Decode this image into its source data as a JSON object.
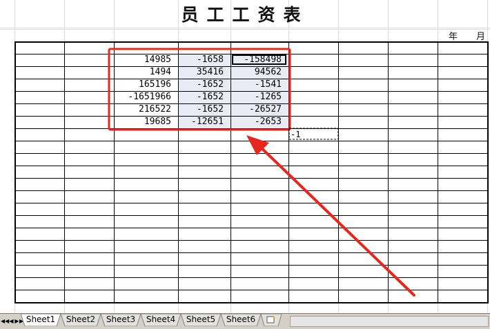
{
  "sheet": {
    "title": "员工工资表",
    "year_label": "年",
    "month_label": "月",
    "values": [
      [
        "14985",
        "-1658",
        "-158498"
      ],
      [
        "1494",
        "35416",
        "94562"
      ],
      [
        "165196",
        "-1652",
        "-1541"
      ],
      [
        "-1651966",
        "-1652",
        "-1265"
      ],
      [
        "216522",
        "-1652",
        "-26527"
      ],
      [
        "19685",
        "-12651",
        "-2653"
      ]
    ],
    "copied_cell_value": "-1"
  },
  "tabs": [
    "Sheet1",
    "Sheet2",
    "Sheet3",
    "Sheet4",
    "Sheet5",
    "Sheet6"
  ],
  "active_tab": "Sheet1",
  "colors": {
    "highlight": "#e9ecf5",
    "annotation_red": "#e8261e",
    "tab_bar": "#d4d0c8"
  },
  "icons": {
    "nav": [
      "first-sheet-icon",
      "prev-sheet-icon",
      "next-sheet-icon",
      "last-sheet-icon"
    ],
    "new_sheet": "insert-sheet-icon"
  }
}
